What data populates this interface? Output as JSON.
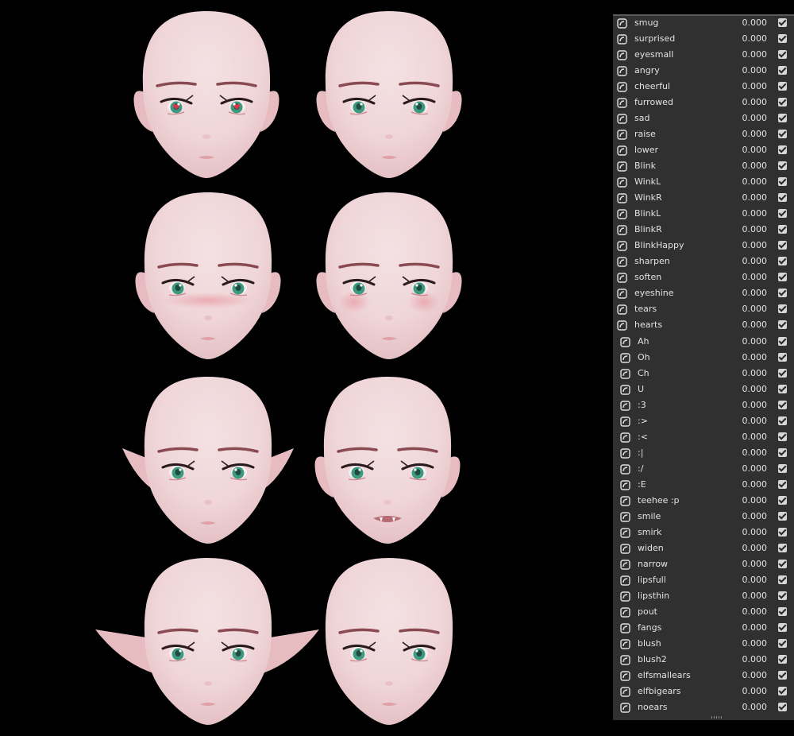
{
  "viewport": {
    "background": "#000000",
    "faces": [
      {
        "name": "face-heart-eyes",
        "ears": "human",
        "extra": "heart-pupils"
      },
      {
        "name": "face-plain",
        "ears": "human",
        "extra": "none"
      },
      {
        "name": "face-nose-blush",
        "ears": "human",
        "extra": "blush-band"
      },
      {
        "name": "face-cheek-blush",
        "ears": "human",
        "extra": "cheek-blush"
      },
      {
        "name": "face-elf-small-ears",
        "ears": "elf-small",
        "extra": "none"
      },
      {
        "name": "face-fangs",
        "ears": "human",
        "extra": "fangs"
      },
      {
        "name": "face-elf-big-ears",
        "ears": "elf-big",
        "extra": "none"
      },
      {
        "name": "face-no-ears",
        "ears": "none",
        "extra": "none"
      }
    ]
  },
  "colors": {
    "skin": "#f2d7d9",
    "skin_shade": "#e6bcc1",
    "brow": "#8a4a52",
    "iris": "#3d9a80",
    "lip": "#e0a0a8",
    "panel_bg": "#303030",
    "text": "#e2e2e2"
  },
  "shape_keys": {
    "group1": [
      {
        "name": "smug",
        "value": "0.000"
      },
      {
        "name": "surprised",
        "value": "0.000"
      },
      {
        "name": "eyesmall",
        "value": "0.000"
      },
      {
        "name": "angry",
        "value": "0.000"
      },
      {
        "name": "cheerful",
        "value": "0.000"
      },
      {
        "name": "furrowed",
        "value": "0.000"
      },
      {
        "name": "sad",
        "value": "0.000"
      },
      {
        "name": "raise",
        "value": "0.000"
      },
      {
        "name": "lower",
        "value": "0.000"
      },
      {
        "name": "Blink",
        "value": "0.000"
      },
      {
        "name": "WinkL",
        "value": "0.000"
      },
      {
        "name": "WinkR",
        "value": "0.000"
      },
      {
        "name": "BlinkL",
        "value": "0.000"
      },
      {
        "name": "BlinkR",
        "value": "0.000"
      },
      {
        "name": "BlinkHappy",
        "value": "0.000"
      },
      {
        "name": "sharpen",
        "value": "0.000"
      },
      {
        "name": "soften",
        "value": "0.000"
      },
      {
        "name": "eyeshine",
        "value": "0.000"
      },
      {
        "name": "tears",
        "value": "0.000"
      },
      {
        "name": "hearts",
        "value": "0.000"
      }
    ],
    "group2": [
      {
        "name": "Ah",
        "value": "0.000"
      },
      {
        "name": "Oh",
        "value": "0.000"
      },
      {
        "name": "Ch",
        "value": "0.000"
      },
      {
        "name": "U",
        "value": "0.000"
      },
      {
        "name": ":3",
        "value": "0.000"
      },
      {
        "name": ":>",
        "value": "0.000"
      },
      {
        "name": ":<",
        "value": "0.000"
      },
      {
        "name": ":|",
        "value": "0.000"
      },
      {
        "name": ":/",
        "value": "0.000"
      },
      {
        "name": ":E",
        "value": "0.000"
      },
      {
        "name": "teehee :p",
        "value": "0.000"
      },
      {
        "name": "smile",
        "value": "0.000"
      },
      {
        "name": "smirk",
        "value": "0.000"
      },
      {
        "name": "widen",
        "value": "0.000"
      },
      {
        "name": "narrow",
        "value": "0.000"
      },
      {
        "name": "lipsfull",
        "value": "0.000"
      },
      {
        "name": "lipsthin",
        "value": "0.000"
      },
      {
        "name": "pout",
        "value": "0.000"
      },
      {
        "name": "fangs",
        "value": "0.000"
      },
      {
        "name": "blush",
        "value": "0.000"
      },
      {
        "name": "blush2",
        "value": "0.000"
      },
      {
        "name": "elfsmallears",
        "value": "0.000"
      },
      {
        "name": "elfbigears",
        "value": "0.000"
      },
      {
        "name": "noears",
        "value": "0.000"
      }
    ]
  }
}
